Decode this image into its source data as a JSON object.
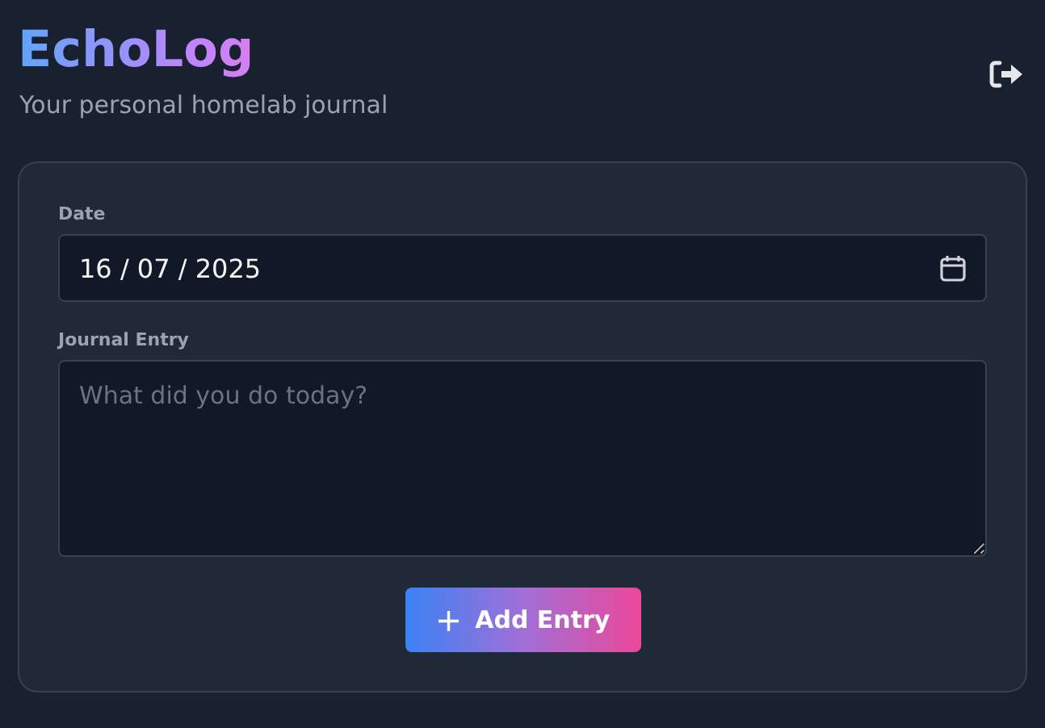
{
  "header": {
    "title": "EchoLog",
    "subtitle": "Your personal homelab journal"
  },
  "form": {
    "date_label": "Date",
    "date_value": "16 / 07 / 2025",
    "entry_label": "Journal Entry",
    "entry_placeholder": "What did you do today?",
    "submit": {
      "icon": "+",
      "label": "Add Entry"
    }
  }
}
